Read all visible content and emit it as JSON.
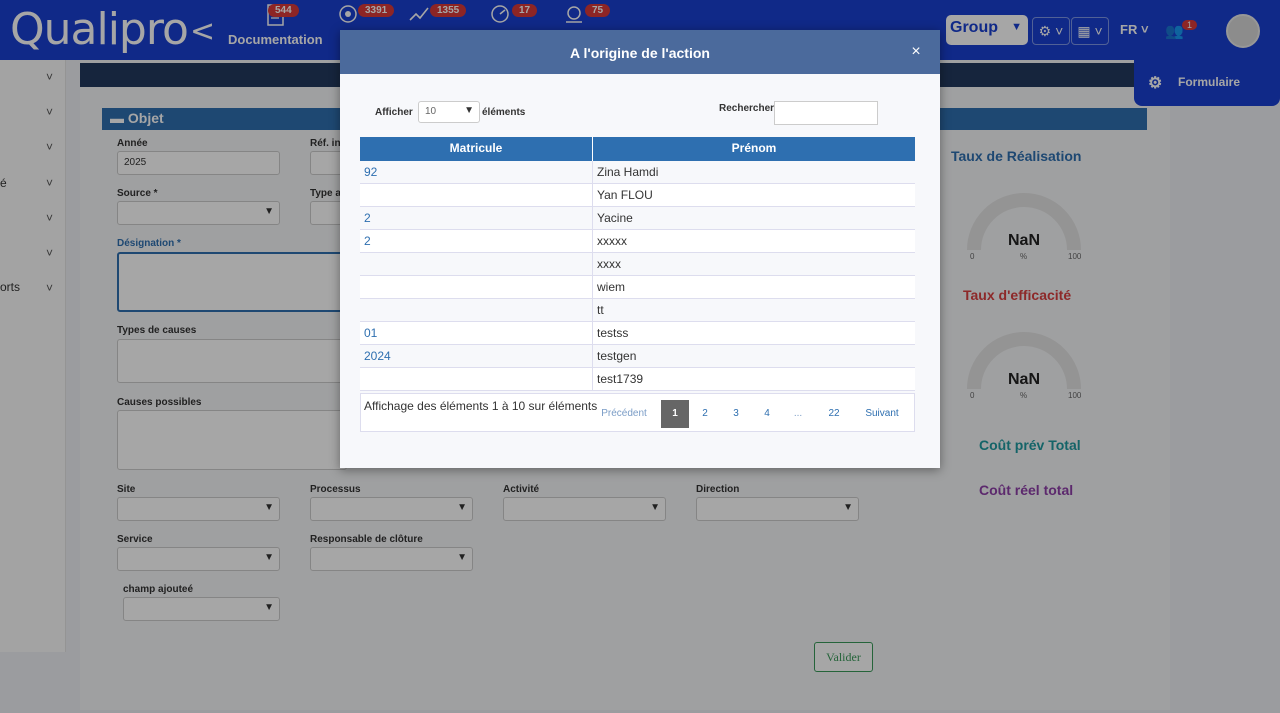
{
  "app": {
    "logo": "Qualipro",
    "logo_chevron": "<"
  },
  "topnav": {
    "items": [
      {
        "label": "Documentation",
        "badge": "544",
        "icon": "document-icon"
      },
      {
        "label": "",
        "badge": "3391",
        "icon": "audit-icon"
      },
      {
        "label": "",
        "badge": "1355",
        "icon": "actions-icon"
      },
      {
        "label": "",
        "badge": "17",
        "icon": "dashboard-icon"
      },
      {
        "label": "",
        "badge": "75",
        "icon": "incident-icon"
      }
    ],
    "group_select": "Group",
    "lang": "FR",
    "users_badge": "1"
  },
  "formulaire": {
    "label": "Formulaire"
  },
  "sidebar": {
    "fragments": [
      "é",
      "orts"
    ]
  },
  "form": {
    "section_title": "Objet",
    "annee_label": "Année",
    "annee_value": "2025",
    "ref_label": "Réf. in",
    "source_label": "Source *",
    "type_label": "Type a",
    "designation_label": "Désignation *",
    "types_causes_label": "Types de causes",
    "causes_possibles_label": "Causes possibles",
    "site_label": "Site",
    "processus_label": "Processus",
    "activite_label": "Activité",
    "direction_label": "Direction",
    "service_label": "Service",
    "responsable_label": "Responsable de clôture",
    "champ_label": "champ ajouteé",
    "valider_label": "Valider"
  },
  "gauges": {
    "realisation_title": "Taux de Réalisation",
    "efficacite_title": "Taux d'efficacité",
    "value": "NaN",
    "min": "0",
    "unit": "%",
    "max": "100",
    "cout_prev": "Coût prév Total",
    "cout_reel": "Coût réel total"
  },
  "modal": {
    "title": "A l'origine de l'action",
    "close_symbol": "×",
    "show_label": "Afficher",
    "show_value": "10",
    "show_suffix": "éléments",
    "search_label": "Rechercher",
    "columns": [
      "Matricule",
      "Prénom"
    ],
    "rows": [
      {
        "matricule": "92",
        "prenom": "Zina Hamdi"
      },
      {
        "matricule": "",
        "prenom": "Yan FLOU"
      },
      {
        "matricule": "2",
        "prenom": "Yacine"
      },
      {
        "matricule": "2",
        "prenom": "xxxxx"
      },
      {
        "matricule": "",
        "prenom": "xxxx"
      },
      {
        "matricule": "",
        "prenom": "wiem"
      },
      {
        "matricule": "",
        "prenom": "tt"
      },
      {
        "matricule": "01",
        "prenom": "testss"
      },
      {
        "matricule": "2024",
        "prenom": "testgen"
      },
      {
        "matricule": "",
        "prenom": "test1739"
      }
    ],
    "info": "Affichage des éléments 1 à 10 sur éléments",
    "pagination": {
      "prev": "Précédent",
      "pages": [
        "1",
        "2",
        "3",
        "4",
        "...",
        "22"
      ],
      "next": "Suivant"
    }
  }
}
